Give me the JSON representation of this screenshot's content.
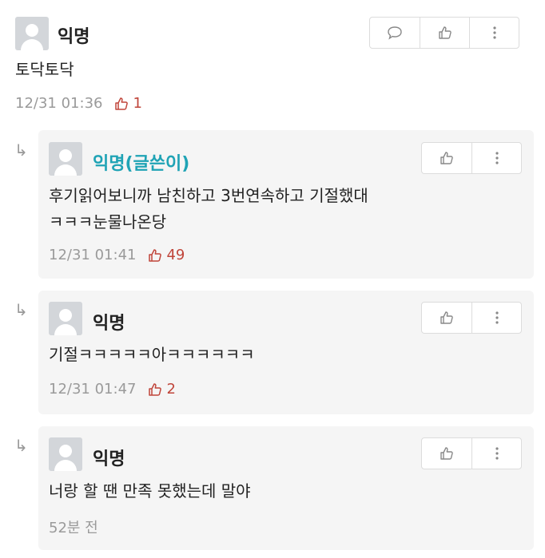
{
  "post": {
    "author": "익명",
    "content": "토닥토닥",
    "time": "12/31 01:36",
    "likes": "1"
  },
  "replies": [
    {
      "author": "익명(글쓴이)",
      "is_op": true,
      "lines": [
        "후기읽어보니까 남친하고 3번연속하고 기절했대",
        "ㅋㅋㅋ눈물나온당"
      ],
      "time": "12/31 01:41",
      "likes": "49"
    },
    {
      "author": "익명",
      "is_op": false,
      "lines": [
        "기절ㅋㅋㅋㅋㅋ아ㅋㅋㅋㅋㅋㅋ"
      ],
      "time": "12/31 01:47",
      "likes": "2"
    },
    {
      "author": "익명",
      "is_op": false,
      "lines": [
        "너랑 할 땐 만족 못했는데 말야"
      ],
      "time": "52분 전",
      "likes": ""
    }
  ],
  "icons": {
    "reply_arrow": "↳",
    "comment": "speech-bubble-icon",
    "like": "thumbs-up-icon",
    "more": "vertical-dots-icon"
  },
  "colors": {
    "op_author": "#1fa3b5",
    "like_count": "#c0453a",
    "meta": "#9a9a9a",
    "reply_bg": "#f5f5f5"
  }
}
